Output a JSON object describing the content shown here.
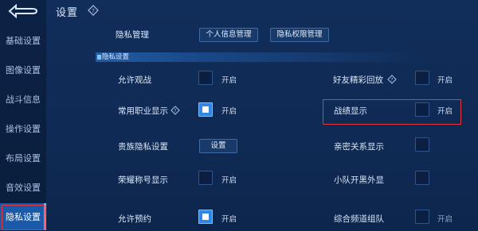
{
  "sidebar": {
    "items": [
      {
        "label": "基础设置"
      },
      {
        "label": "图像设置"
      },
      {
        "label": "战斗信息"
      },
      {
        "label": "操作设置"
      },
      {
        "label": "布局设置"
      },
      {
        "label": "音效设置"
      },
      {
        "label": "隐私设置",
        "active": true
      }
    ]
  },
  "header": {
    "title": "设置"
  },
  "privacy_manage": {
    "label": "隐私管理",
    "personal_info_btn": "个人信息管理",
    "permission_btn": "隐私权限管理"
  },
  "section": {
    "title": "隐私设置"
  },
  "settings": {
    "allow_watch": {
      "label": "允许观战",
      "state_label": "开启",
      "checked": false
    },
    "friend_highlight": {
      "label": "好友精彩回放",
      "state_label": "开启",
      "checked": false
    },
    "common_role": {
      "label": "常用职业显示",
      "state_label": "开启",
      "checked": true
    },
    "battle_record": {
      "label": "战绩显示",
      "state_label": "开启",
      "checked": false
    },
    "noble_privacy": {
      "label": "贵族隐私设置",
      "button_label": "设置"
    },
    "intimate_relation": {
      "label": "亲密关系显示",
      "checked": false
    },
    "honor_title": {
      "label": "荣耀称号显示",
      "state_label": "开启",
      "checked": false
    },
    "team_black": {
      "label": "小队开黑外显",
      "checked": false
    },
    "allow_reserve": {
      "label": "允许预约",
      "state_label": "开启",
      "checked": true
    },
    "channel_team": {
      "label": "综合频道组队",
      "state_label": "开启",
      "checked": false
    }
  },
  "colors": {
    "accent": "#2f86e6",
    "highlight_outline": "#e6343b",
    "background": "#0e2750"
  },
  "icons": {
    "back": "back-arrow-icon",
    "help": "question-diamond-icon"
  }
}
